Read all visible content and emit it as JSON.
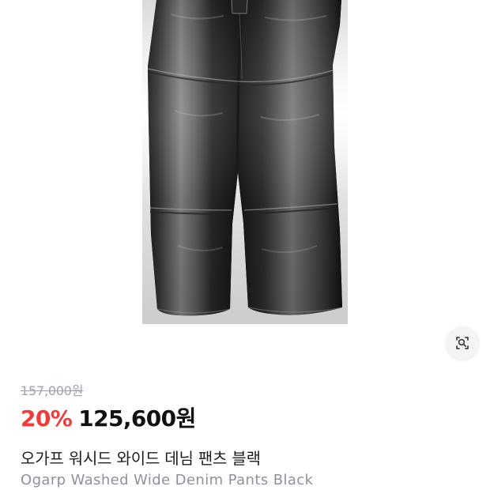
{
  "product": {
    "image_alt": "Ogarp Washed Wide Denim Pants Black",
    "original_price": "157,000원",
    "discount": "20%",
    "sale_price": "125,600원",
    "name_ko": "오가프 워시드 와이드 데님 팬츠 블랙",
    "name_en": "Ogarp Washed Wide Denim Pants Black"
  },
  "icons": {
    "lens": "visual-search-icon"
  },
  "colors": {
    "discount": "#ef3b3b",
    "original_price": "#a0a4aa",
    "sale_price": "#111111",
    "english_name": "#8d929a"
  }
}
